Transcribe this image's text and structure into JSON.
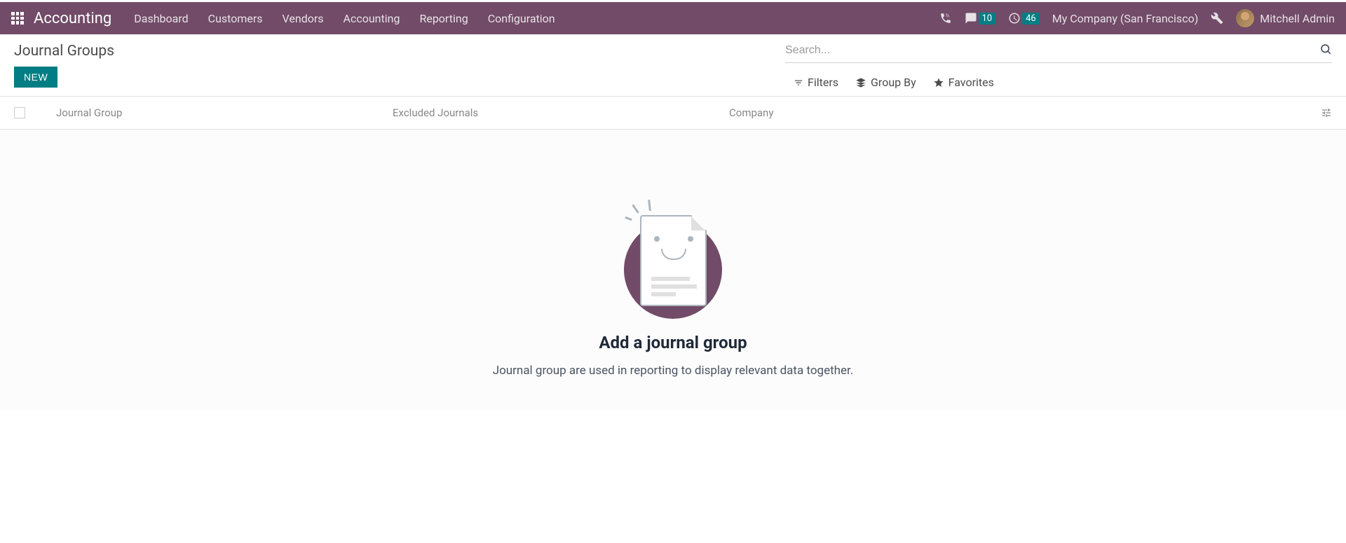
{
  "nav": {
    "app_title": "Accounting",
    "menu": [
      "Dashboard",
      "Customers",
      "Vendors",
      "Accounting",
      "Reporting",
      "Configuration"
    ],
    "messages_badge": "10",
    "activities_badge": "46",
    "company_name": "My Company (San Francisco)",
    "user_name": "Mitchell Admin"
  },
  "control_panel": {
    "breadcrumb": "Journal Groups",
    "new_button": "NEW",
    "search_placeholder": "Search...",
    "filters_label": "Filters",
    "groupby_label": "Group By",
    "favorites_label": "Favorites"
  },
  "list": {
    "columns": {
      "journal_group": "Journal Group",
      "excluded_journals": "Excluded Journals",
      "company": "Company"
    }
  },
  "empty_state": {
    "title": "Add a journal group",
    "description": "Journal group are used in reporting to display relevant data together."
  }
}
